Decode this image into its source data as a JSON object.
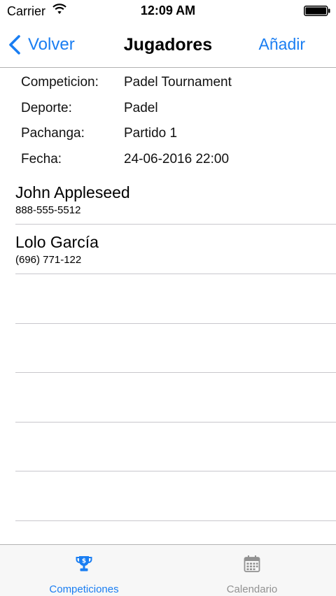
{
  "status_bar": {
    "carrier": "Carrier",
    "time": "12:09 AM",
    "wifi_icon": "wifi-icon",
    "battery_icon": "battery-icon"
  },
  "nav": {
    "back_label": "Volver",
    "title": "Jugadores",
    "add_label": "Añadir",
    "accent_color": "#1a7ef2"
  },
  "details": [
    {
      "label": "Competicion:",
      "value": "Padel Tournament"
    },
    {
      "label": "Deporte:",
      "value": "Padel"
    },
    {
      "label": "Pachanga:",
      "value": "Partido 1"
    },
    {
      "label": "Fecha:",
      "value": "24-06-2016 22:00"
    }
  ],
  "players": [
    {
      "name": "John Appleseed",
      "phone": "888-555-5512"
    },
    {
      "name": "Lolo García",
      "phone": "(696) 771-122"
    }
  ],
  "tabs": [
    {
      "label": "Competiciones",
      "icon": "trophy-icon",
      "selected": true,
      "color": "#1a7ef2"
    },
    {
      "label": "Calendario",
      "icon": "calendar-icon",
      "selected": false,
      "color": "#929292"
    }
  ]
}
